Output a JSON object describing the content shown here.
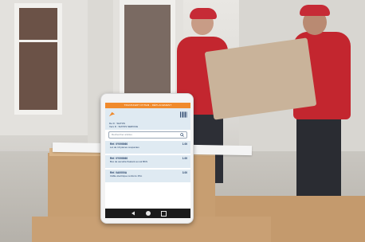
{
  "app": {
    "header_title": "TRANSFERT D'ITEM - DÉPLACEMENT",
    "meta_line1": "De D : SIATOS",
    "meta_line2": "Vers D : SIATOS SERVICE",
    "search_placeholder": "Rechercher articles"
  },
  "items": [
    {
      "ref": "Réf. 0Y090060",
      "desc": "Lot de 10 pièces coupantes",
      "qty": "1.00"
    },
    {
      "ref": "Réf. 0Y090060",
      "desc": "Box de sécurité floatant au sol BKS",
      "qty": "1.00"
    },
    {
      "ref": "Réf. 0A0000A",
      "desc": "Câble électrique renforcé 15m",
      "qty": "3.00"
    }
  ],
  "icons": {
    "logo": "app-logo-icon",
    "barcode": "barcode-icon",
    "search": "search-icon",
    "back": "back-triangle-icon",
    "home": "home-circle-icon",
    "recent": "recent-square-icon"
  },
  "colors": {
    "accent": "#f08a2c",
    "list_bg": "#dfeaf2",
    "text": "#1f3c64"
  }
}
